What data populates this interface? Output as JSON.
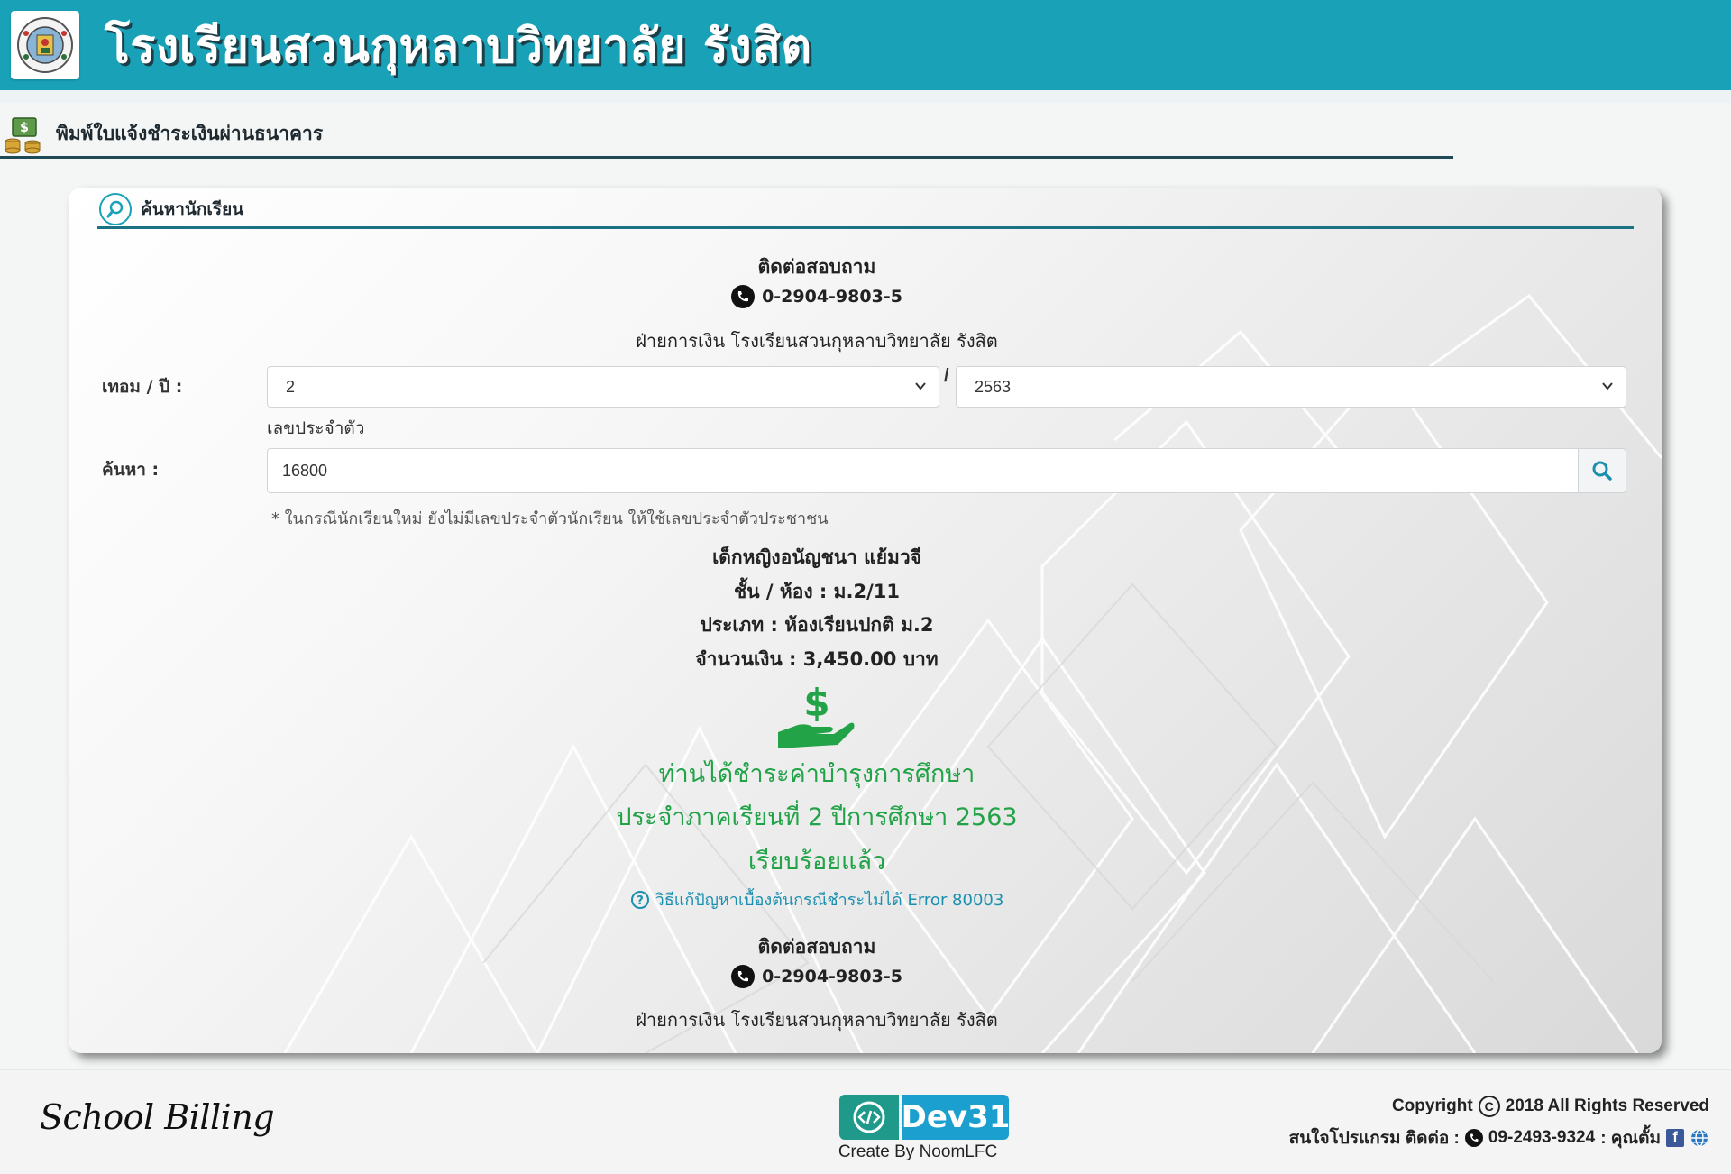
{
  "header": {
    "school_name": "โรงเรียนสวนกุหลาบวิทยาลัย รังสิต",
    "logo_icon": "school-emblem"
  },
  "section": {
    "title": "พิมพ์ใบแจ้งชำระเงินผ่านธนาคาร",
    "icon": "money-stack-icon"
  },
  "card": {
    "title": "ค้นหานักเรียน",
    "contact_top": {
      "title": "ติดต่อสอบถาม",
      "phone": "0-2904-9803-5",
      "department": "ฝ่ายการเงิน โรงเรียนสวนกุหลาบวิทยาลัย รังสิต"
    },
    "form": {
      "term_year_label": "เทอม / ปี :",
      "term_value": "2",
      "year_separator": "/",
      "year_value": "2563",
      "id_sublabel": "เลขประจำตัว",
      "search_label": "ค้นหา :",
      "search_value": "16800",
      "hint": "* ในกรณีนักเรียนใหม่ ยังไม่มีเลขประจำตัวนักเรียน ให้ใช้เลขประจำตัวประชาชน"
    },
    "student": {
      "name": "เด็กหญิงอนัญชนา แย้มวจี",
      "class_room": "ชั้น / ห้อง : ม.2/11",
      "type": "ประเภท : ห้องเรียนปกติ ม.2",
      "amount": "จำนวนเงิน : 3,450.00 บาท"
    },
    "payment_status": {
      "line1": "ท่านได้ชำระค่าบำรุงการศึกษา",
      "line2": "ประจำภาคเรียนที่ 2 ปีการศึกษา 2563",
      "line3": "เรียบร้อยแล้ว",
      "color": "#22a348"
    },
    "help_link": "วิธีแก้ปัญหาเบื้องต้นกรณีชำระไม่ได้ Error 80003",
    "contact_bottom": {
      "title": "ติดต่อสอบถาม",
      "phone": "0-2904-9803-5",
      "department": "ฝ่ายการเงิน โรงเรียนสวนกุหลาบวิทยาลัย รังสิต"
    }
  },
  "footer": {
    "brand": "School Billing",
    "dev_logo_text": "Dev31",
    "dev_credit": "Create By NoomLFC",
    "copyright_prefix": "Copyright",
    "copyright_rest": "2018 All Rights Reserved",
    "contact_prefix": "สนใจโปรแกรม ติดต่อ :",
    "contact_phone": "09-2493-9324",
    "contact_name": ": คุณตั้ม"
  },
  "colors": {
    "header_bg": "#19a1b8",
    "accent_line": "#1a7383",
    "success_green": "#22a348",
    "link_blue": "#1a8fb0"
  }
}
